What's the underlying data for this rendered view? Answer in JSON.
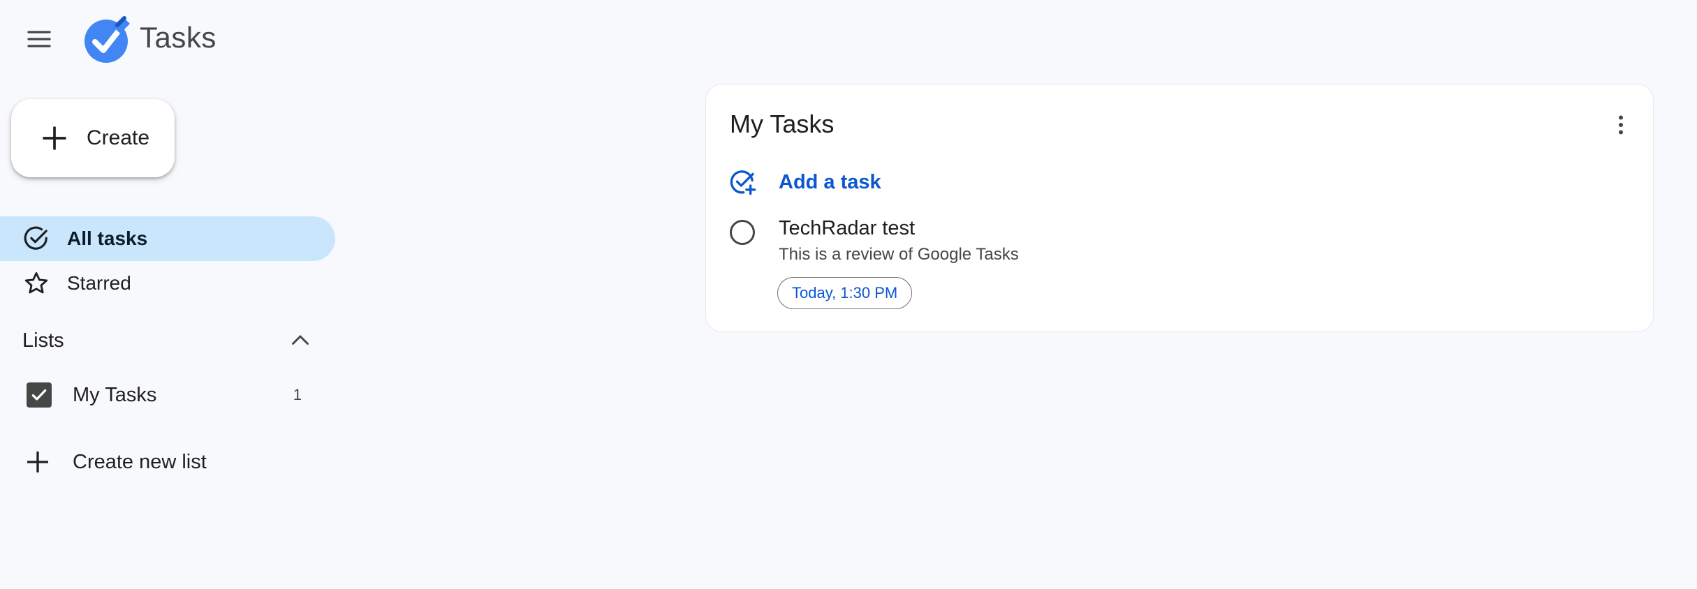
{
  "header": {
    "menu_icon": "hamburger-menu-icon",
    "logo_icon": "google-tasks-logo",
    "title": "Tasks"
  },
  "sidebar": {
    "create_label": "Create",
    "nav": [
      {
        "label": "All tasks",
        "icon": "check-circle-icon",
        "active": true
      },
      {
        "label": "Starred",
        "icon": "star-outline-icon",
        "active": false
      }
    ],
    "lists_header": "Lists",
    "lists": [
      {
        "label": "My Tasks",
        "count": "1",
        "checked": true
      }
    ],
    "create_new_list_label": "Create new list"
  },
  "main": {
    "card_title": "My Tasks",
    "add_task_label": "Add a task",
    "tasks": [
      {
        "title": "TechRadar test",
        "description": "This is a review of Google Tasks",
        "due": "Today, 1:30 PM"
      }
    ]
  },
  "colors": {
    "background": "#f8f9fd",
    "active_nav": "#c9e6fd",
    "accent_blue": "#0b57d0",
    "logo_blue": "#4285f4"
  }
}
